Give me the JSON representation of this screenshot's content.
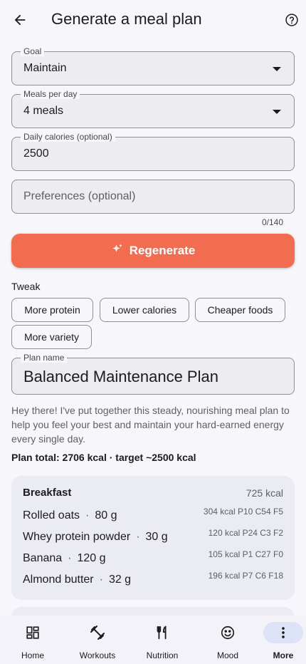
{
  "header": {
    "title": "Generate a meal plan"
  },
  "form": {
    "goal": {
      "label": "Goal",
      "value": "Maintain"
    },
    "meals": {
      "label": "Meals per day",
      "value": "4 meals"
    },
    "calories": {
      "label": "Daily calories (optional)",
      "value": "2500"
    },
    "preferences": {
      "placeholder": "Preferences (optional)",
      "counter": "0/140"
    },
    "regenerate_label": "Regenerate"
  },
  "tweak": {
    "label": "Tweak",
    "chips": [
      "More protein",
      "Lower calories",
      "Cheaper foods",
      "More variety"
    ]
  },
  "plan": {
    "name_label": "Plan name",
    "name": "Balanced Maintenance Plan",
    "description": "Hey there! I've put together this steady, nourishing meal plan to help you feel your best and maintain your hard-earned energy every single day.",
    "total": "Plan total: 2706 kcal  ·  target ~2500 kcal"
  },
  "meal": {
    "title": "Breakfast",
    "kcal": "725 kcal",
    "foods": [
      {
        "name": "Rolled oats",
        "qty": "80 g",
        "macros": "304 kcal  P10  C54  F5"
      },
      {
        "name": "Whey protein powder",
        "qty": "30 g",
        "macros": "120 kcal  P24  C3  F2"
      },
      {
        "name": "Banana",
        "qty": "120 g",
        "macros": "105 kcal  P1  C27  F0"
      },
      {
        "name": "Almond butter",
        "qty": "32 g",
        "macros": "196 kcal  P7  C6  F18"
      }
    ]
  },
  "nav": {
    "items": [
      {
        "label": "Home",
        "icon": "dashboard-icon"
      },
      {
        "label": "Workouts",
        "icon": "fitness-icon"
      },
      {
        "label": "Nutrition",
        "icon": "restaurant-icon"
      },
      {
        "label": "Mood",
        "icon": "smiley-icon"
      },
      {
        "label": "More",
        "icon": "more-vert-icon"
      }
    ],
    "active": "More"
  },
  "colors": {
    "accent": "#f26d4f",
    "nav_active_pill": "#dde3f6",
    "card_bg": "#ebebf3"
  }
}
